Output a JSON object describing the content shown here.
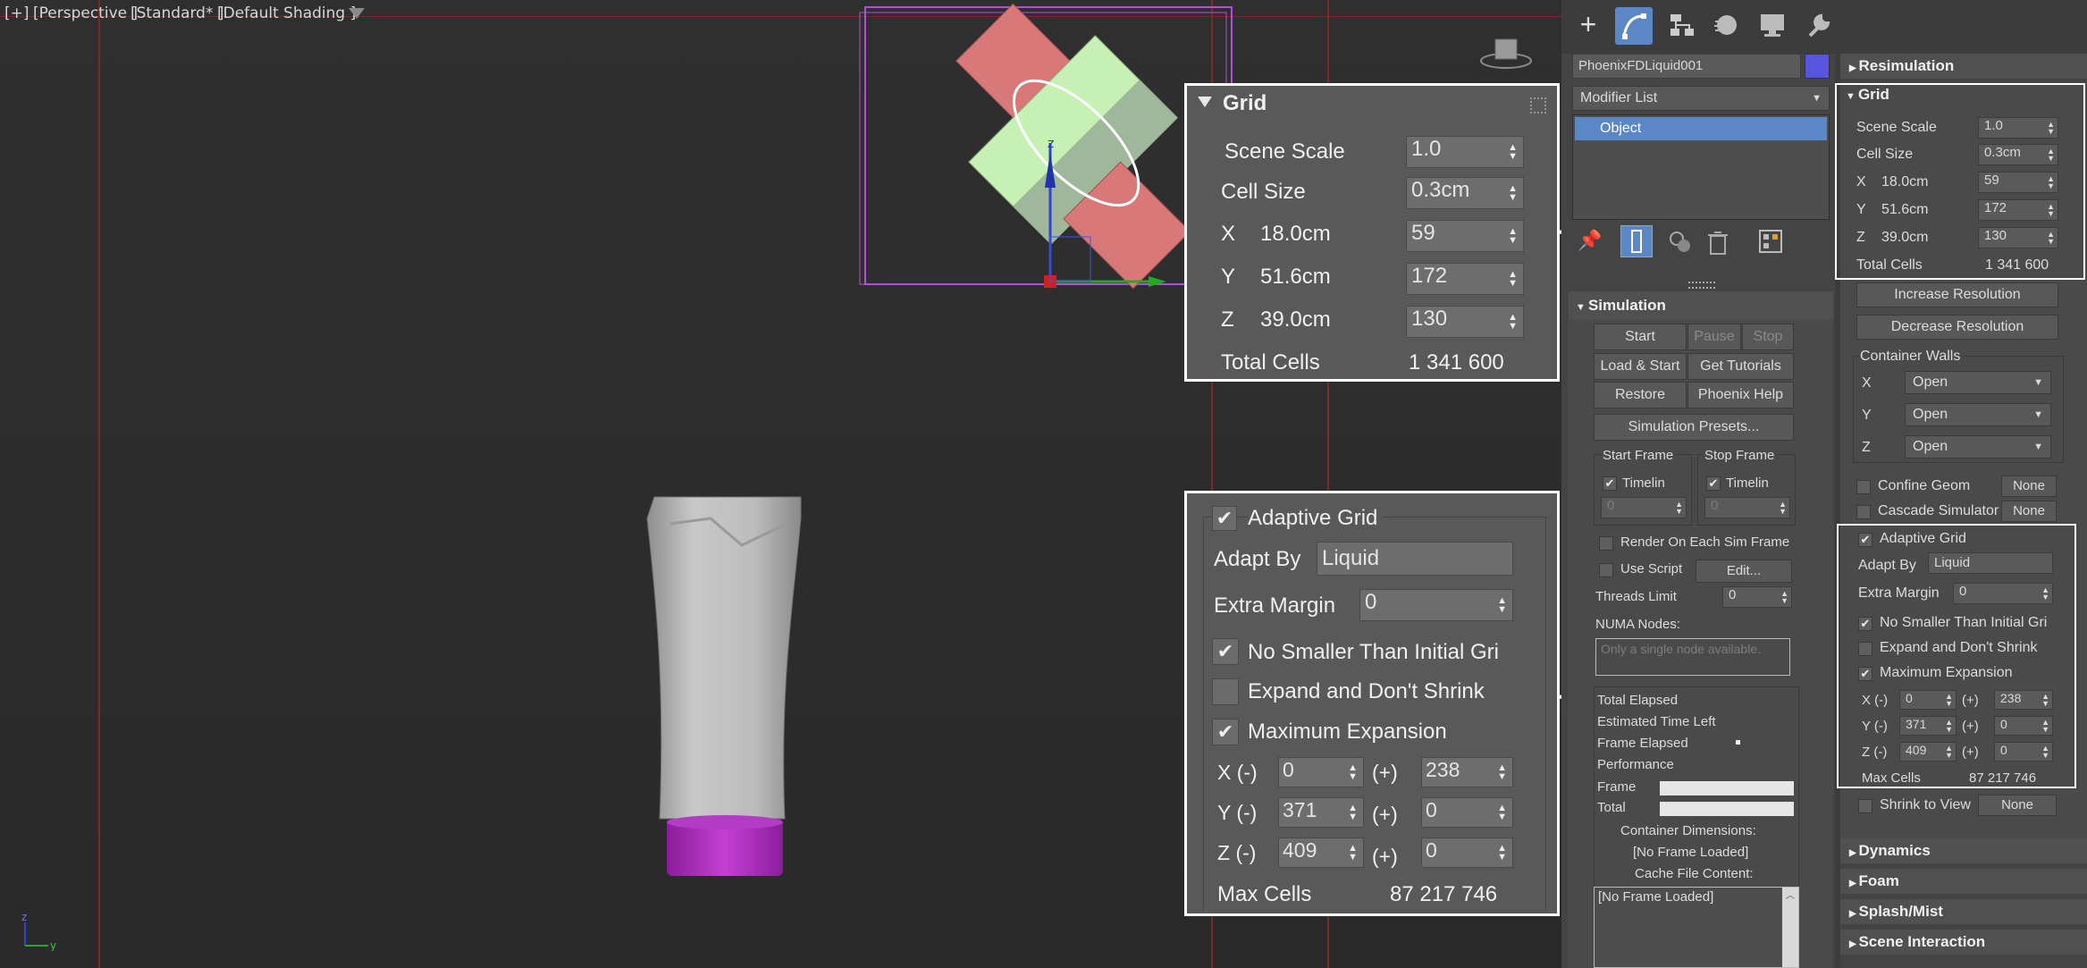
{
  "viewport": {
    "labels": [
      "[+]",
      "[Perspective ]",
      "[Standard* ]",
      "[Default Shading ]"
    ],
    "axis": {
      "z": "z",
      "y": "y"
    }
  },
  "zoom_grid": {
    "title": "Grid",
    "scene_scale_label": "Scene Scale",
    "scene_scale": "1.0",
    "cell_size_label": "Cell Size",
    "cell_size": "0.3cm",
    "x_label": "X",
    "x_dim": "18.0cm",
    "x_val": "59",
    "y_label": "Y",
    "y_dim": "51.6cm",
    "y_val": "172",
    "z_label": "Z",
    "z_dim": "39.0cm",
    "z_val": "130",
    "total_label": "Total Cells",
    "total": "1 341 600"
  },
  "zoom_adaptive": {
    "title": "Adaptive Grid",
    "adapt_by_label": "Adapt By",
    "adapt_by": "Liquid",
    "extra_margin_label": "Extra Margin",
    "extra_margin": "0",
    "no_smaller": "No Smaller Than Initial Gri",
    "expand": "Expand and Don't Shrink",
    "max_exp": "Maximum Expansion",
    "xm_label": "X (-)",
    "xm": "0",
    "plus": "(+)",
    "xp": "238",
    "ym_label": "Y (-)",
    "ym": "371",
    "yp": "0",
    "zm_label": "Z (-)",
    "zm": "409",
    "zp": "0",
    "max_cells_label": "Max Cells",
    "max_cells": "87 217 746"
  },
  "panel": {
    "colors": {
      "object_color": "#5555dd",
      "selected": "#5b87c6"
    },
    "object_name": "PhoenixFDLiquid001",
    "modifier_list": "Modifier List",
    "stack_item": "Object",
    "simulation": {
      "title": "Simulation",
      "start": "Start",
      "pause": "Pause",
      "stop": "Stop",
      "load_start": "Load & Start",
      "tutorials": "Get Tutorials",
      "restore": "Restore",
      "help": "Phoenix Help",
      "presets": "Simulation Presets...",
      "start_frame": "Start Frame",
      "stop_frame": "Stop Frame",
      "timeline": "Timelin",
      "frame_val": "0",
      "render_each": "Render On Each Sim Frame",
      "use_script": "Use Script",
      "edit": "Edit...",
      "threads_label": "Threads Limit",
      "threads": "0",
      "numa_label": "NUMA Nodes:",
      "numa_placeholder": "Only a single node available.",
      "total_elapsed": "Total Elapsed",
      "est_left": "Estimated Time Left",
      "frame_elapsed": "Frame Elapsed",
      "performance": "Performance",
      "frame": "Frame",
      "total": "Total",
      "container_dims": "Container Dimensions:",
      "no_frame": "[No Frame Loaded]",
      "cache_content": "Cache File Content:",
      "cache_value": "[No Frame Loaded]"
    },
    "right": {
      "resimulation": "Resimulation",
      "grid": "Grid",
      "scene_scale_label": "Scene Scale",
      "scene_scale": "1.0",
      "cell_size_label": "Cell Size",
      "cell_size": "0.3cm",
      "x_label": "X",
      "x_dim": "18.0cm",
      "x_val": "59",
      "y_label": "Y",
      "y_dim": "51.6cm",
      "y_val": "172",
      "z_label": "Z",
      "z_dim": "39.0cm",
      "z_val": "130",
      "total_label": "Total Cells",
      "total": "1 341 600",
      "inc_res": "Increase Resolution",
      "dec_res": "Decrease Resolution",
      "walls": "Container Walls",
      "wx": "X",
      "wy": "Y",
      "wz": "Z",
      "open": "Open",
      "confine": "Confine Geom",
      "cascade": "Cascade Simulator",
      "none": "None",
      "adaptive": "Adaptive Grid",
      "adapt_by_label": "Adapt By",
      "adapt_by": "Liquid",
      "extra_label": "Extra Margin",
      "extra": "0",
      "no_smaller": "No Smaller Than Initial Gri",
      "expand": "Expand and Don't Shrink",
      "max_exp": "Maximum Expansion",
      "xm_label": "X (-)",
      "xm": "0",
      "plus": "(+)",
      "xp": "238",
      "ym_label": "Y (-)",
      "ym": "371",
      "yp": "0",
      "zm_label": "Z (-)",
      "zm": "409",
      "zp": "0",
      "max_cells_label": "Max Cells",
      "max_cells": "87 217 746",
      "shrink": "Shrink to View",
      "dynamics": "Dynamics",
      "foam": "Foam",
      "splash": "Splash/Mist",
      "scene_int": "Scene Interaction"
    }
  }
}
